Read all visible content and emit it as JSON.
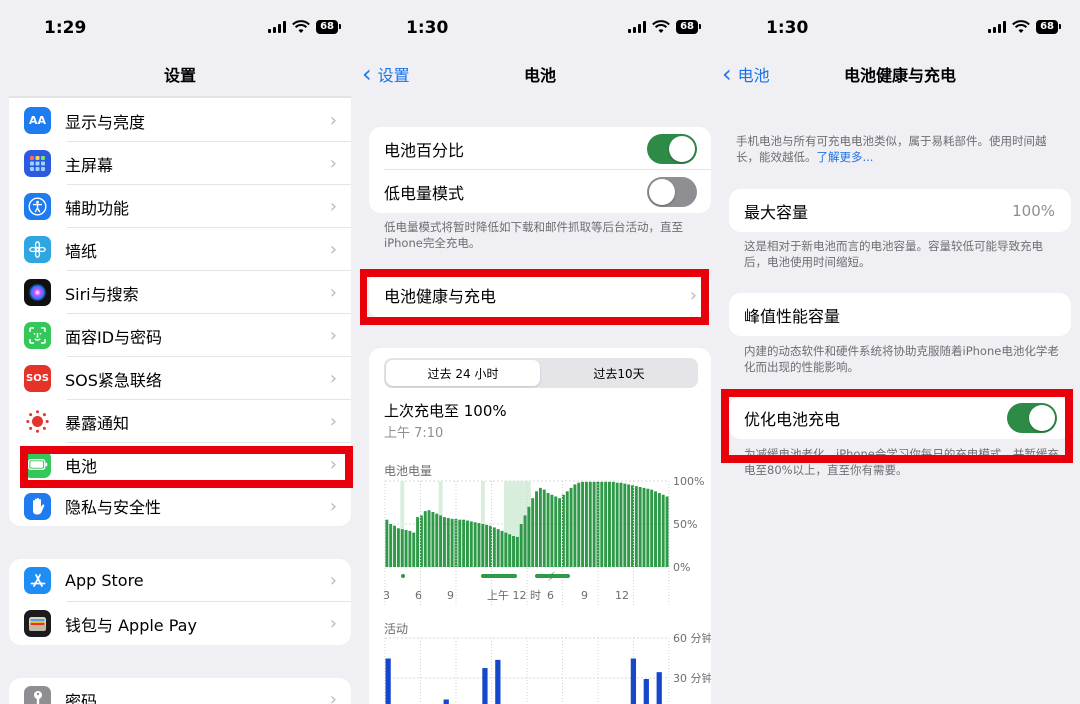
{
  "panels": [
    {
      "time": "1:29",
      "battery": "68",
      "title": "设置",
      "group1": [
        {
          "label": "显示与亮度",
          "icon_text": "AA",
          "color": "#1e7cf0"
        },
        {
          "label": "主屏幕",
          "icon_text": "",
          "color": "#2d5be0"
        },
        {
          "label": "辅助功能",
          "icon_text": "",
          "color": "#1e7cf0"
        },
        {
          "label": "墙纸",
          "icon_text": "",
          "color": "#30a6e0"
        },
        {
          "label": "Siri与搜索",
          "icon_text": "",
          "color": "#222"
        },
        {
          "label": "面容ID与密码",
          "icon_text": "",
          "color": "#34c759"
        },
        {
          "label": "SOS紧急联络",
          "icon_text": "SOS",
          "color": "#e5332a"
        },
        {
          "label": "暴露通知",
          "icon_text": "",
          "color": "#fff"
        },
        {
          "label": "电池",
          "icon_text": "",
          "color": "#34c759"
        },
        {
          "label": "隐私与安全性",
          "icon_text": "",
          "color": "#1e7cf0"
        }
      ],
      "group2": [
        {
          "label": "App Store",
          "icon_text": "",
          "color": "#1e8ef5"
        },
        {
          "label": "钱包与 Apple Pay",
          "icon_text": "",
          "color": "#1c1c1e"
        }
      ],
      "group3": [
        {
          "label": "密码",
          "icon_text": "",
          "color": "#8e8e93"
        }
      ]
    },
    {
      "time": "1:30",
      "battery": "68",
      "back": "设置",
      "title": "电池",
      "toggles": [
        {
          "label": "电池百分比",
          "on": true
        },
        {
          "label": "低电量模式",
          "on": false
        }
      ],
      "lowpower_note": "低电量模式将暂时降低如下载和邮件抓取等后台活动，直至iPhone完全充电。",
      "health_row": "电池健康与充电",
      "seg_24h": "过去 24 小时",
      "seg_10d": "过去10天",
      "last_charge": "上次充电至 100%",
      "last_charge_time": "上午 7:10",
      "level_label": "电池电量",
      "level_ticks": [
        "100%",
        "50%",
        "0%"
      ],
      "x_ticks": [
        "3",
        "6",
        "9",
        "上午 12 时",
        "6",
        "9",
        "12"
      ],
      "activity_label": "活动",
      "activity_ticks": [
        "60 分钟",
        "30 分钟"
      ]
    },
    {
      "time": "1:30",
      "battery": "68",
      "back": "电池",
      "title": "电池健康与充电",
      "intro": "手机电池与所有可充电电池类似，属于易耗部件。使用时间越长，能效越低。",
      "learn_more": "了解更多...",
      "max_capacity_label": "最大容量",
      "max_capacity_value": "100%",
      "max_capacity_note": "这是相对于新电池而言的电池容量。容量较低可能导致充电后，电池使用时间缩短。",
      "peak_label": "峰值性能容量",
      "peak_note": "内建的动态软件和硬件系统将协助克服随着iPhone电池化学老化而出现的性能影响。",
      "optimize_label": "优化电池充电",
      "optimize_on": true,
      "optimize_note": "为减缓电池老化，iPhone会学习你每日的充电模式，并暂缓充电至80%以上，直至你有需要。"
    }
  ],
  "chart_data": [
    {
      "type": "bar",
      "title": "电池电量",
      "ylim": [
        0,
        100
      ],
      "ytick_labels": [
        "100%",
        "50%",
        "0%"
      ],
      "xtick_labels": [
        "3",
        "6",
        "9",
        "上午 12 时",
        "6",
        "9",
        "12"
      ],
      "values": [
        55,
        50,
        48,
        45,
        44,
        43,
        42,
        40,
        58,
        60,
        65,
        66,
        64,
        62,
        60,
        58,
        57,
        56,
        56,
        55,
        55,
        54,
        53,
        52,
        51,
        50,
        49,
        48,
        46,
        44,
        42,
        40,
        38,
        36,
        35,
        50,
        60,
        70,
        80,
        88,
        92,
        90,
        86,
        84,
        82,
        80,
        84,
        88,
        92,
        96,
        98,
        99,
        99,
        99,
        99,
        99,
        99,
        99,
        99,
        99,
        98,
        98,
        97,
        96,
        95,
        94,
        93,
        92,
        91,
        90,
        88,
        86,
        84,
        82
      ],
      "charging_shade_indices": [
        4,
        14,
        25,
        31,
        32,
        33,
        34,
        35,
        36,
        37
      ]
    },
    {
      "type": "bar",
      "title": "活动",
      "ytick_labels": [
        "60 分钟",
        "30 分钟"
      ],
      "values": [
        45,
        0,
        0,
        0,
        0,
        0,
        0,
        0,
        0,
        15,
        0,
        0,
        0,
        0,
        0,
        38,
        0,
        44,
        0,
        0,
        0,
        0,
        0,
        0,
        0,
        0,
        0,
        0,
        0,
        0,
        0,
        0,
        8,
        0,
        0,
        0,
        0,
        0,
        45,
        0,
        30,
        0,
        35,
        0
      ]
    }
  ]
}
